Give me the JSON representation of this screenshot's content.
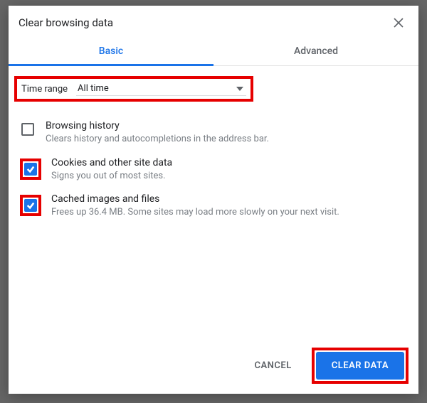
{
  "dialog": {
    "title": "Clear browsing data"
  },
  "tabs": {
    "basic": "Basic",
    "advanced": "Advanced"
  },
  "time_range": {
    "label": "Time range",
    "value": "All time"
  },
  "options": {
    "history": {
      "title": "Browsing history",
      "desc": "Clears history and autocompletions in the address bar.",
      "checked": false
    },
    "cookies": {
      "title": "Cookies and other site data",
      "desc": "Signs you out of most sites.",
      "checked": true
    },
    "cache": {
      "title": "Cached images and files",
      "desc": "Frees up 36.4 MB. Some sites may load more slowly on your next visit.",
      "checked": true
    }
  },
  "buttons": {
    "cancel": "CANCEL",
    "clear": "CLEAR DATA"
  }
}
